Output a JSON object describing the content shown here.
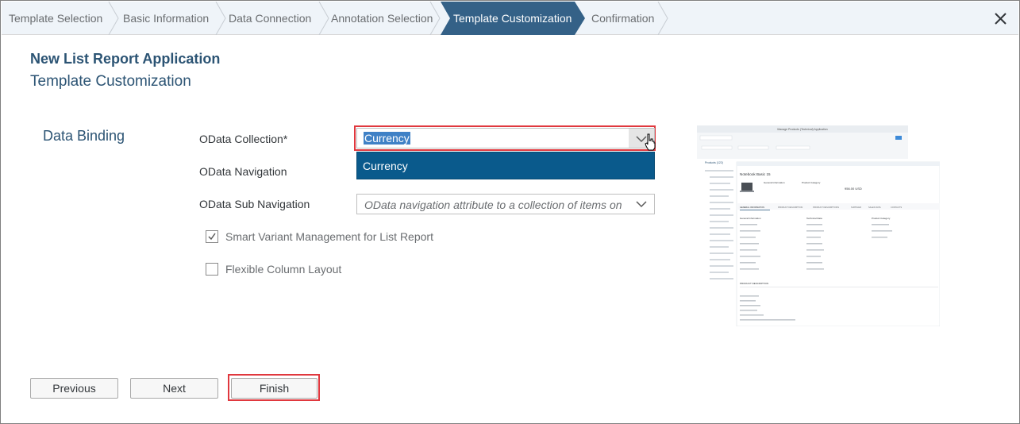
{
  "wizard": {
    "steps": [
      {
        "label": "Template Selection"
      },
      {
        "label": "Basic Information"
      },
      {
        "label": "Data Connection"
      },
      {
        "label": "Annotation Selection"
      },
      {
        "label": "Template Customization"
      },
      {
        "label": "Confirmation"
      }
    ],
    "active_step": 4,
    "close_icon": "close-icon"
  },
  "header": {
    "app_title": "New List Report Application",
    "step_title": "Template Customization"
  },
  "form": {
    "section_label": "Data Binding",
    "odata_collection": {
      "label": "OData Collection*",
      "value": "Currency"
    },
    "dropdown_items": [
      "Currency"
    ],
    "odata_navigation": {
      "label": "OData Navigation"
    },
    "odata_sub_navigation": {
      "label": "OData Sub Navigation",
      "placeholder": "OData navigation attribute to a collection of items on"
    },
    "checkboxes": [
      {
        "label": "Smart Variant Management for List Report",
        "checked": true
      },
      {
        "label": "Flexible Column Layout",
        "checked": false
      }
    ]
  },
  "preview": {
    "title": "Manage Products (Technical) Application",
    "list_header": "Products (122)",
    "object_title": "Notebook Basic 15",
    "object_price": "956.00 USD",
    "tabs": [
      "GENERAL INFORMATION",
      "PRODUCT DESCRIPTION",
      "PRODUCT DESCRIPTIONS",
      "SUPPLIER",
      "SALES DATA",
      "CONTACTS"
    ],
    "group_labels": [
      "General Information",
      "Technical Data",
      "Product Category"
    ],
    "section_title": "PRODUCT DESCRIPTION"
  },
  "footer": {
    "previous_label": "Previous",
    "next_label": "Next",
    "finish_label": "Finish"
  },
  "colors": {
    "active_step": "#346187",
    "title": "#2c5474",
    "highlight": "#e0383e",
    "dropdown_selected": "#0a5a8c"
  }
}
